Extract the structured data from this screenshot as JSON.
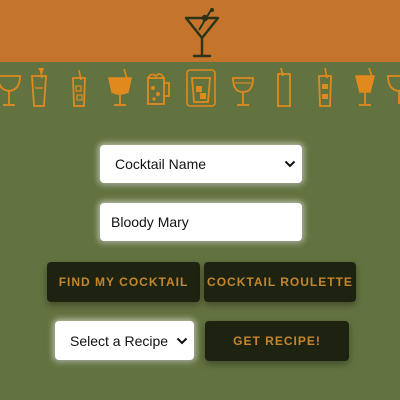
{
  "colors": {
    "header": "#c4752b",
    "background": "#637340",
    "button_bg": "#1e2311",
    "button_text": "#c4852b",
    "icon_orange": "#e08a1e",
    "icon_dark": "#2b3318"
  },
  "header": {
    "logo_icon": "martini-glass-icon"
  },
  "icon_strip": {
    "icons": [
      "wine-glass-icon",
      "highball-glass-icon",
      "mojito-glass-icon",
      "cocktail-glass-icon",
      "beer-mug-icon",
      "rocks-glass-icon",
      "coupe-glass-icon",
      "tall-glass-icon",
      "collins-glass-icon",
      "hurricane-glass-icon",
      "wine-glass-icon"
    ]
  },
  "search": {
    "type_select_value": "Cocktail Name",
    "query_value": "Bloody Mary"
  },
  "buttons": {
    "find_label": "FIND MY COCKTAIL",
    "roulette_label": "COCKTAIL ROULETTE",
    "get_recipe_label": "GET RECIPE!"
  },
  "recipe": {
    "select_value": "Select a Recipe"
  }
}
